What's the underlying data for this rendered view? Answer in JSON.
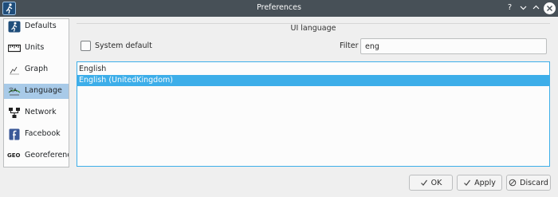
{
  "window": {
    "title": "Preferences",
    "help_glyph": "?",
    "colors": {
      "titlebar": "#475057",
      "accent": "#3daee9",
      "selection": "#a8cae8"
    }
  },
  "sidebar": {
    "items": [
      {
        "label": "Defaults",
        "icon": "walker-icon"
      },
      {
        "label": "Units",
        "icon": "ruler-icon"
      },
      {
        "label": "Graph",
        "icon": "graph-icon"
      },
      {
        "label": "Language",
        "icon": "language-icon",
        "selected": true
      },
      {
        "label": "Network",
        "icon": "network-icon"
      },
      {
        "label": "Facebook",
        "icon": "facebook-icon"
      },
      {
        "label": "Georeference",
        "icon": "geo-icon",
        "icon_text": "GEO"
      }
    ]
  },
  "language": {
    "section_title": "UI language",
    "system_default_label": "System default",
    "system_default_checked": false,
    "filter_label": "Filter",
    "filter_value": "eng",
    "list": [
      {
        "label": "English",
        "selected": false
      },
      {
        "label": "English (UnitedKingdom)",
        "selected": true
      }
    ]
  },
  "buttons": {
    "ok": "OK",
    "apply": "Apply",
    "discard": "Discard"
  }
}
